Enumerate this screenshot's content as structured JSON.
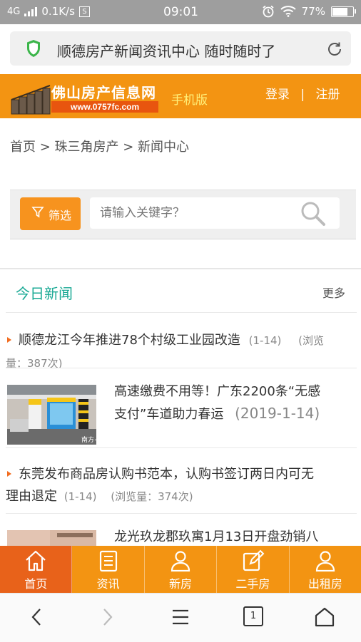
{
  "status_bar": {
    "network": "4G",
    "speed": "0.1K/s",
    "sim_badge": "S",
    "time": "09:01",
    "battery": "77%"
  },
  "url_bar": {
    "text": "顺德房产新闻资讯中心 随时随时了"
  },
  "header": {
    "logo_text": "佛山房产信息网",
    "logo_url": "www.0757fc.com",
    "mobile_label": "手机版",
    "login": "登录",
    "separator": "|",
    "register": "注册"
  },
  "breadcrumb": "首页 > 珠三角房产 > 新闻中心",
  "search": {
    "filter_label": "筛选",
    "placeholder": "请输入关键字？"
  },
  "section": {
    "title": "今日新闻",
    "more": "更多"
  },
  "news": [
    {
      "title": "顺德龙江今年推进78个村级工业园改造",
      "date": "(1-14)",
      "views_line1": "(浏览",
      "views_line2": "量：387次)"
    },
    {
      "title_line1": "高速缴费不用等！广东2200条“无感",
      "title_line2": "支付”车道助力春运",
      "date": "(2019-1-14)",
      "watermark": "南方+"
    },
    {
      "title_line1": "东莞发布商品房认购书范本，认购书签订两日内可无",
      "title_line2": "理由退定",
      "date": "(1-14)",
      "views": "(浏览量：374次)"
    },
    {
      "title": "龙光玖龙郡玖寓1月13日开盘劲销八"
    }
  ],
  "tabs": [
    {
      "label": "首页",
      "icon": "home-icon"
    },
    {
      "label": "资讯",
      "icon": "news-icon"
    },
    {
      "label": "新房",
      "icon": "user-icon"
    },
    {
      "label": "二手房",
      "icon": "edit-icon"
    },
    {
      "label": "出租房",
      "icon": "user-icon"
    }
  ],
  "browser_nav": {
    "tab_count": "1"
  },
  "colors": {
    "brand_orange": "#f39412",
    "active_tab": "#e8621a",
    "section_title": "#19a994"
  }
}
